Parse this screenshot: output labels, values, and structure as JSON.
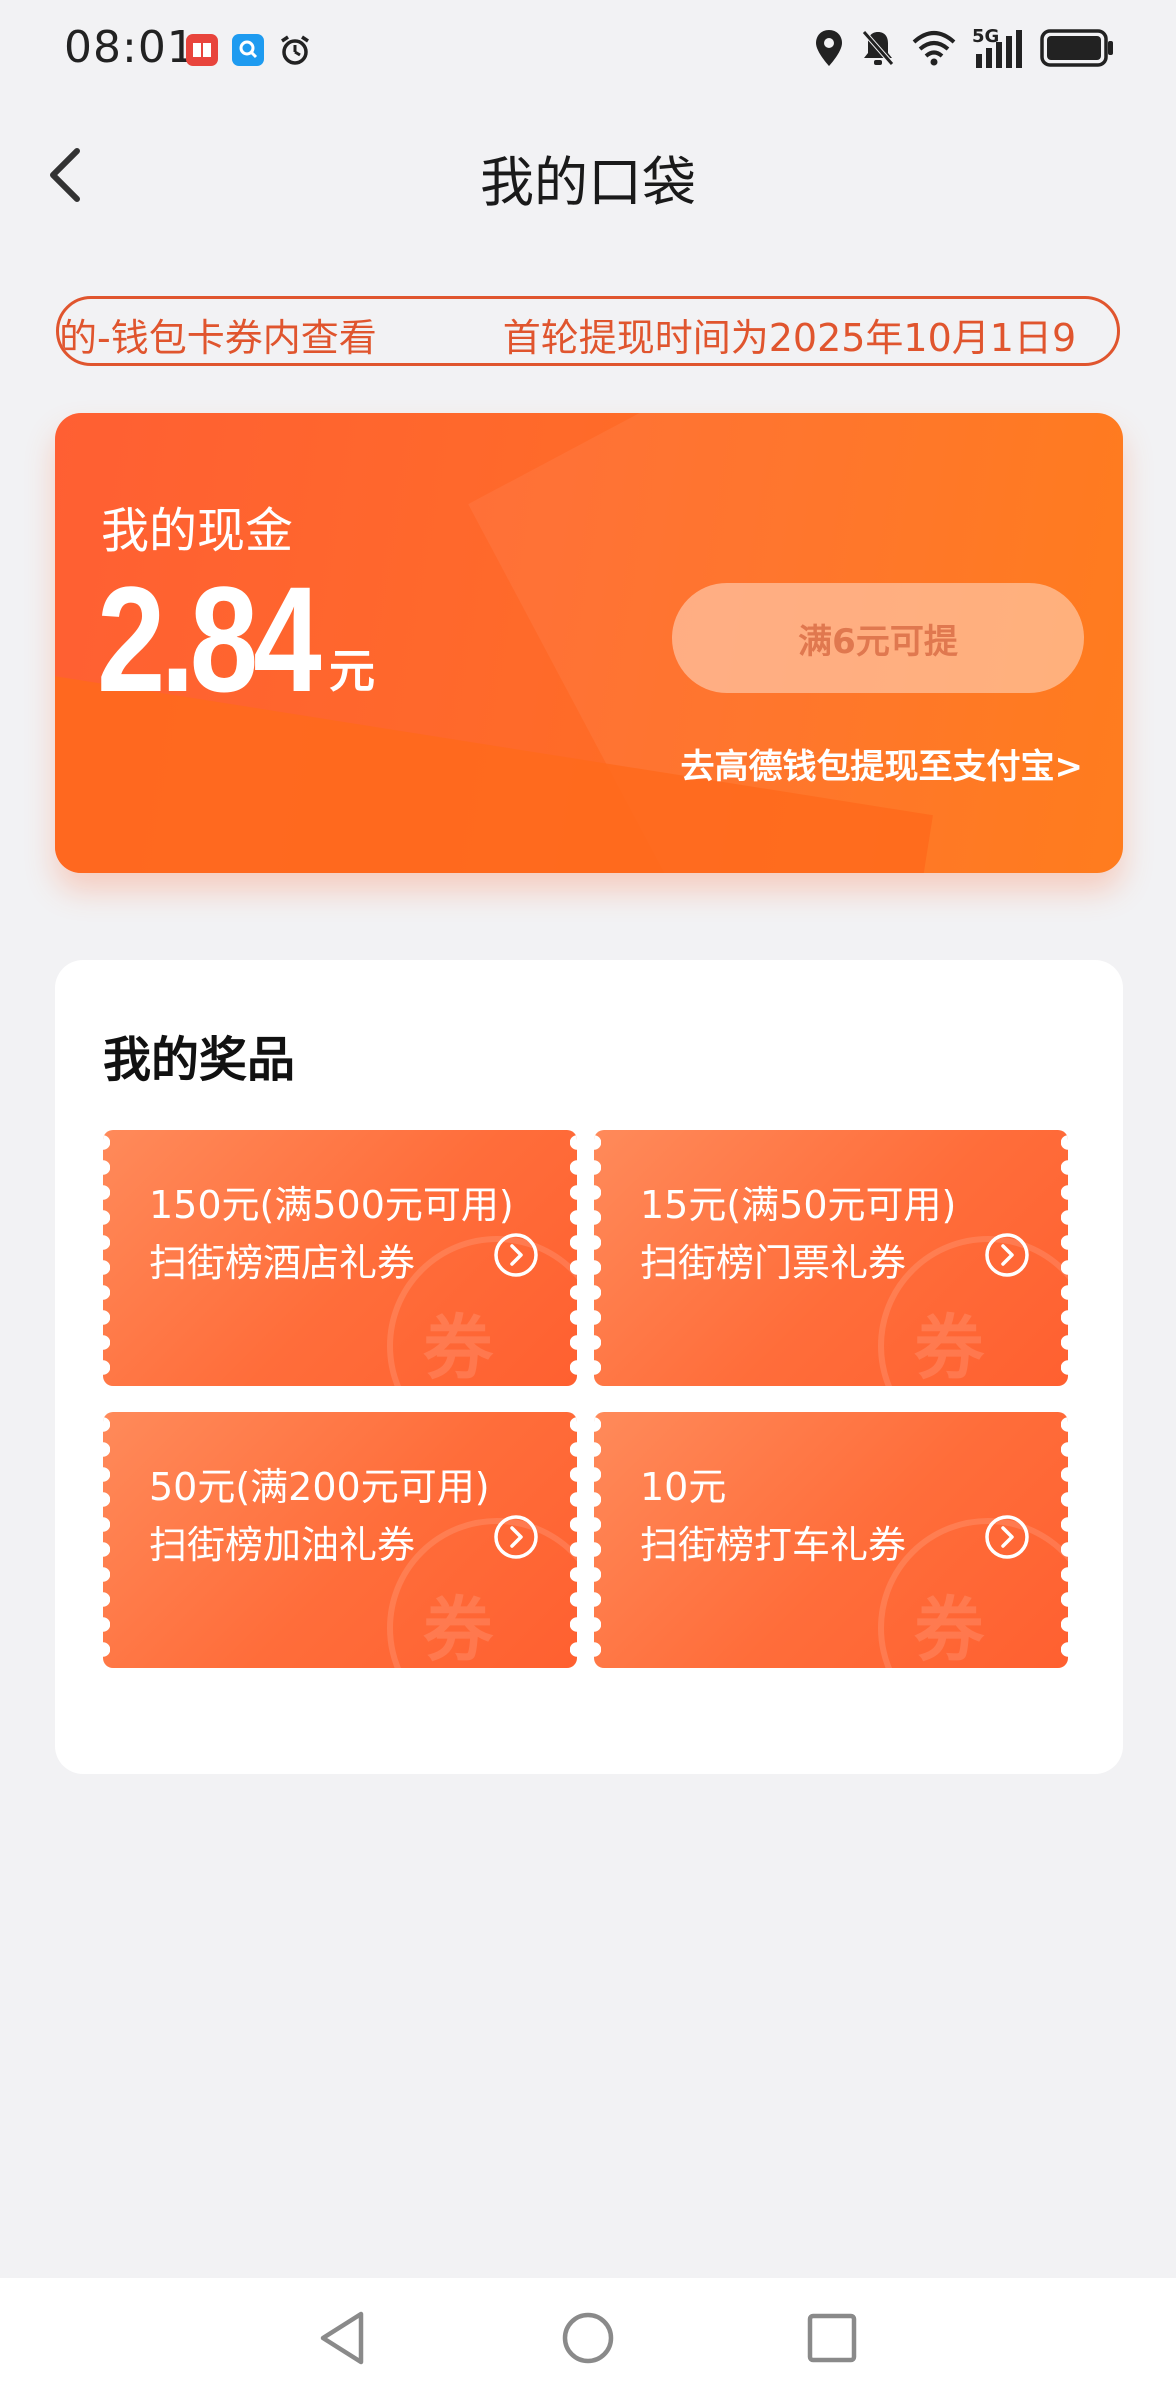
{
  "status_bar": {
    "time": "08:01",
    "network_label": "5G",
    "icons": [
      "book-app-icon",
      "search-app-icon",
      "alarm-icon",
      "location-icon",
      "mute-icon",
      "wifi-icon",
      "signal-icon",
      "battery-icon"
    ]
  },
  "nav": {
    "title": "我的口袋"
  },
  "marquee": {
    "text_a": "的-钱包卡券内查看",
    "text_b": "首轮提现时间为2025年10月1日9"
  },
  "cash_card": {
    "label": "我的现金",
    "amount": "2.84",
    "unit": "元",
    "withdraw_button": "满6元可提",
    "wallet_link": "去高德钱包提现至支付宝>"
  },
  "prizes": {
    "title": "我的奖品",
    "watermark": "券",
    "coupons": [
      {
        "line1": "150元(满500元可用)",
        "line2": "扫街榜酒店礼券"
      },
      {
        "line1": "15元(满50元可用)",
        "line2": "扫街榜门票礼券"
      },
      {
        "line1": "50元(满200元可用)",
        "line2": "扫街榜加油礼券"
      },
      {
        "line1": "10元",
        "line2": "扫街榜打车礼券"
      }
    ]
  },
  "colors": {
    "accent": "#ff6a2a",
    "marquee": "#e0552e",
    "background": "#f2f2f4"
  }
}
